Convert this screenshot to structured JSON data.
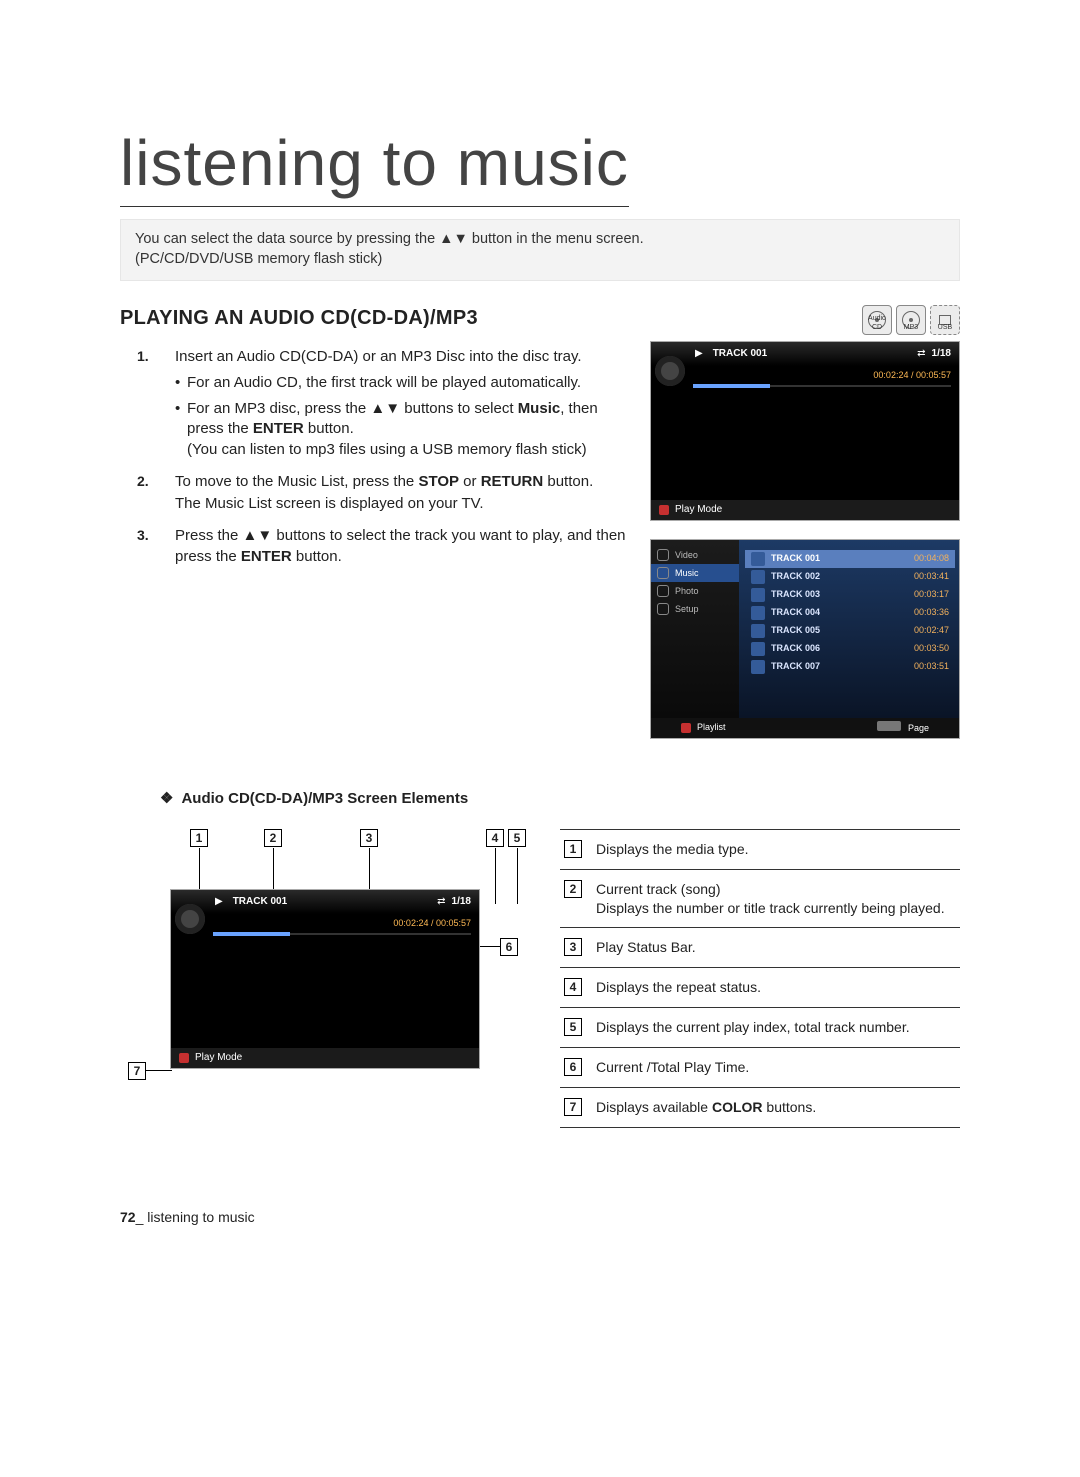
{
  "title": "listening to music",
  "intro": {
    "line1_pre": "You can select the data source by pressing the ",
    "line1_arrows": "▲▼",
    "line1_post": " button in the menu screen.",
    "line2": "(PC/CD/DVD/USB memory flash stick)"
  },
  "section_heading": "PLAYING AN AUDIO CD(CD-DA)/MP3",
  "media_icons": {
    "audio_cd": "Audio CD",
    "mp3": "MP3",
    "usb": "USB"
  },
  "steps": {
    "s1": {
      "num": "1.",
      "text": "Insert an Audio CD(CD-DA) or an MP3 Disc into the disc tray.",
      "b1": "For an Audio CD, the first track will be played automatically.",
      "b2_pre": "For an MP3 disc, press the ",
      "b2_arrows": "▲▼",
      "b2_mid": " buttons to select ",
      "b2_music": "Music",
      "b2_mid2": ", then press the ",
      "b2_enter": "ENTER",
      "b2_post": " button.",
      "b2_paren": "(You can listen to mp3 files using a USB memory flash stick)"
    },
    "s2": {
      "num": "2.",
      "pre": "To move to the Music List, press the ",
      "stop": "STOP",
      "or": " or ",
      "return": "RETURN",
      "post": " button.",
      "extra": "The Music List screen is displayed on your TV."
    },
    "s3": {
      "num": "3.",
      "pre": "Press the ",
      "arrows": "▲▼",
      "mid": " buttons to select the track you want to play, and then press the ",
      "enter": "ENTER",
      "post": " button."
    }
  },
  "player_shot": {
    "play_glyph": "▶",
    "track": "TRACK 001",
    "repeat_glyph": "⇄",
    "index": "1/18",
    "time": "00:02:24 / 00:05:57",
    "footer": "Play Mode"
  },
  "list_shot": {
    "sidebar": {
      "video": "Video",
      "music": "Music",
      "photo": "Photo",
      "setup": "Setup"
    },
    "tracks": [
      {
        "name": "TRACK 001",
        "dur": "00:04:08"
      },
      {
        "name": "TRACK 002",
        "dur": "00:03:41"
      },
      {
        "name": "TRACK 003",
        "dur": "00:03:17"
      },
      {
        "name": "TRACK 004",
        "dur": "00:03:36"
      },
      {
        "name": "TRACK 005",
        "dur": "00:02:47"
      },
      {
        "name": "TRACK 006",
        "dur": "00:03:50"
      },
      {
        "name": "TRACK 007",
        "dur": "00:03:51"
      }
    ],
    "footer_playlist": "Playlist",
    "footer_page": "Page"
  },
  "screen_elements_title": "Audio CD(CD-DA)/MP3 Screen Elements",
  "legend": {
    "1": "Displays the media type.",
    "2a": "Current track (song)",
    "2b": "Displays the number or title track currently being played.",
    "3": "Play Status Bar.",
    "4": "Displays the repeat status.",
    "5": "Displays the current play index, total track number.",
    "6": "Current /Total Play Time.",
    "7_pre": "Displays available ",
    "7_bold": "COLOR",
    "7_post": " buttons."
  },
  "footer": {
    "page_num": "72",
    "sep": "_ ",
    "label": "listening to music"
  }
}
